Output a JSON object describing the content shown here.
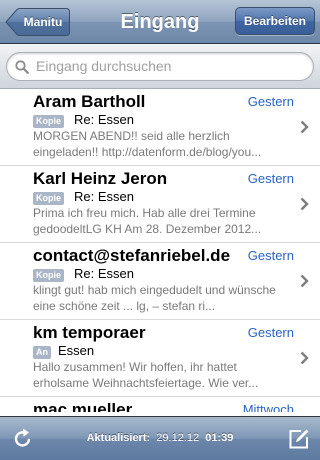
{
  "nav": {
    "back_label": "Manitu",
    "title": "Eingang",
    "edit_label": "Bearbeiten"
  },
  "search": {
    "placeholder": "Eingang durchsuchen"
  },
  "messages": [
    {
      "sender": "Aram Bartholl",
      "date": "Gestern",
      "badge": "Kopie",
      "subject": "Re: Essen",
      "preview": "MORGEN ABEND!! seid alle herzlich eingeladen!! http://datenform.de/blog/you..."
    },
    {
      "sender": "Karl Heinz Jeron",
      "date": "Gestern",
      "badge": "Kopie",
      "subject": "Re: Essen",
      "preview": "Prima ich freu mich. Hab alle drei Termine gedoodeltLG KH Am 28. Dezember 2012..."
    },
    {
      "sender": "contact@stefanriebel.de",
      "date": "Gestern",
      "badge": "Kopie",
      "subject": "Re: Essen",
      "preview": "klingt gut! hab mich eingedudelt und wünsche eine schöne zeit ... lg, – stefan ri..."
    },
    {
      "sender": "km temporaer",
      "date": "Gestern",
      "badge": "An",
      "subject": "Essen",
      "preview": "Hallo zusammen!   Wir hoffen, ihr hattet erholsame Weihnachtsfeiertage.   Wie ver..."
    },
    {
      "sender": "mac mueller",
      "date": "Mittwoch",
      "badge": "",
      "subject": "",
      "preview": ""
    }
  ],
  "toolbar": {
    "updated_label": "Aktualisiert:",
    "updated_date": "29.12.12",
    "updated_time": "01:39"
  },
  "colors": {
    "accent": "#2a64c4",
    "badge": "#a9b6c8",
    "navbar": "#6d87a8"
  },
  "icons": {
    "search": "search-icon",
    "chevron": "chevron-right-icon",
    "refresh": "refresh-icon",
    "compose": "compose-icon"
  }
}
